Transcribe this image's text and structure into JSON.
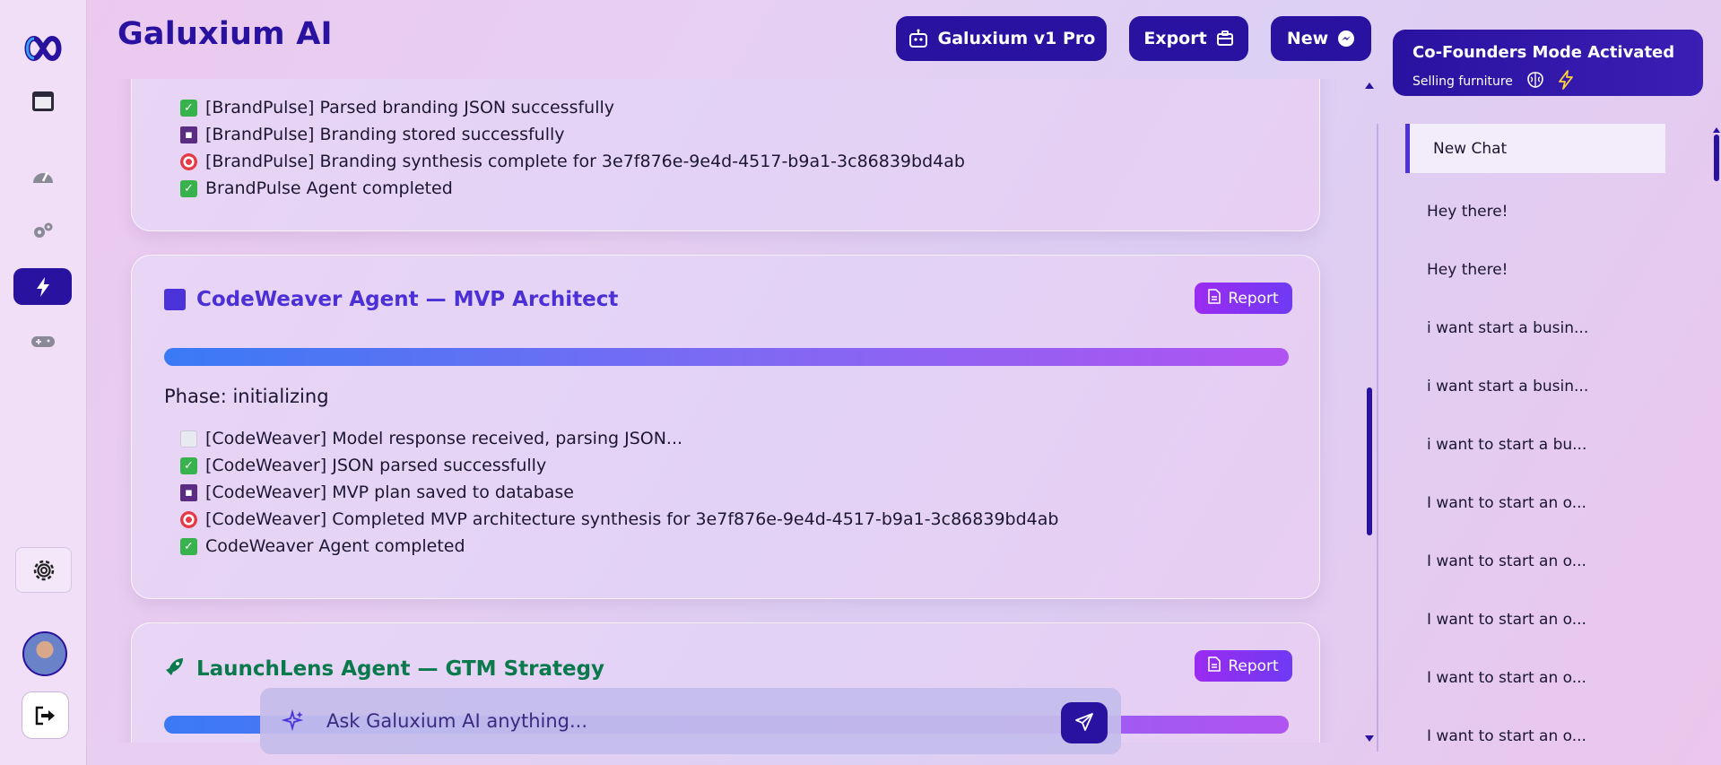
{
  "app": {
    "title": "Galuxium AI"
  },
  "toolbar": {
    "model_label": "Galuxium v1 Pro",
    "export_label": "Export",
    "new_label": "New"
  },
  "cofounder": {
    "title": "Co-Founders Mode Activated",
    "subtitle": "Selling furniture"
  },
  "cards": [
    {
      "logs": [
        {
          "icon": "check",
          "text": "[BrandPulse] Parsed branding JSON successfully"
        },
        {
          "icon": "disk",
          "text": "[BrandPulse] Branding stored successfully"
        },
        {
          "icon": "target",
          "text": "[BrandPulse] Branding synthesis complete for 3e7f876e-9e4d-4517-b9a1-3c86839bd4ab"
        },
        {
          "icon": "check",
          "text": "BrandPulse Agent completed"
        }
      ]
    },
    {
      "title": "CodeWeaver Agent — MVP Architect",
      "report_label": "Report",
      "phase": "Phase: initializing",
      "logs": [
        {
          "icon": "doc",
          "text": "[CodeWeaver] Model response received, parsing JSON..."
        },
        {
          "icon": "check",
          "text": "[CodeWeaver] JSON parsed successfully"
        },
        {
          "icon": "disk",
          "text": "[CodeWeaver] MVP plan saved to database"
        },
        {
          "icon": "target",
          "text": "[CodeWeaver] Completed MVP architecture synthesis for 3e7f876e-9e4d-4517-b9a1-3c86839bd4ab"
        },
        {
          "icon": "check",
          "text": "CodeWeaver Agent completed"
        }
      ]
    },
    {
      "title": "LaunchLens Agent — GTM Strategy",
      "report_label": "Report"
    }
  ],
  "ask": {
    "placeholder": "Ask Galuxium AI anything..."
  },
  "chats": [
    {
      "label": "New Chat",
      "active": true
    },
    {
      "label": "Hey there!"
    },
    {
      "label": "Hey there!"
    },
    {
      "label": "i want start a busin..."
    },
    {
      "label": "i want start a busin..."
    },
    {
      "label": "i want to start a bu..."
    },
    {
      "label": "I want to start an o..."
    },
    {
      "label": "I want to start an o..."
    },
    {
      "label": "I want to start an o..."
    },
    {
      "label": "I want to start an o..."
    },
    {
      "label": "I want to start an o..."
    }
  ],
  "colors": {
    "accent": "#2a12a0",
    "codeweaver_title": "#4b30d6",
    "launchlens_title": "#0a7a4c"
  }
}
